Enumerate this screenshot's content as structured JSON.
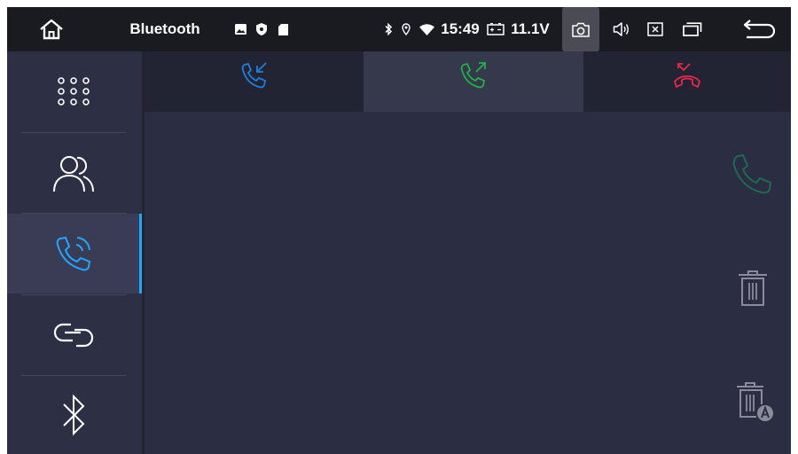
{
  "statusbar": {
    "title": "Bluetooth",
    "time": "15:49",
    "voltage": "11.1V",
    "icons": [
      "home-icon",
      "image-icon",
      "shield-icon",
      "sd-card-icon",
      "bluetooth-status-icon",
      "location-icon",
      "wifi-icon",
      "battery-icon",
      "screenshot-icon",
      "volume-icon",
      "close-box-icon",
      "recent-apps-icon",
      "back-icon"
    ]
  },
  "sidebar": {
    "items": [
      {
        "name": "apps",
        "icon": "apps-grid-icon"
      },
      {
        "name": "contacts",
        "icon": "contacts-icon"
      },
      {
        "name": "call-log",
        "icon": "phone-call-icon",
        "active": true
      },
      {
        "name": "pairing",
        "icon": "link-icon"
      },
      {
        "name": "bluetooth-settings",
        "icon": "bluetooth-icon"
      }
    ],
    "accent": "#1ea7ff"
  },
  "tabs": [
    {
      "name": "incoming-calls",
      "icon": "incoming-call-icon",
      "color": "#1e7fe0"
    },
    {
      "name": "outgoing-calls",
      "icon": "outgoing-call-icon",
      "color": "#1fb24a",
      "active": true
    },
    {
      "name": "missed-calls",
      "icon": "missed-call-icon",
      "color": "#e8294a"
    }
  ],
  "actions": [
    {
      "name": "call",
      "icon": "call-icon",
      "color": "#1f6b52"
    },
    {
      "name": "delete",
      "icon": "trash-icon",
      "color": "#8a8c9c"
    },
    {
      "name": "delete-all",
      "icon": "trash-all-icon",
      "color": "#8a8c9c"
    }
  ]
}
